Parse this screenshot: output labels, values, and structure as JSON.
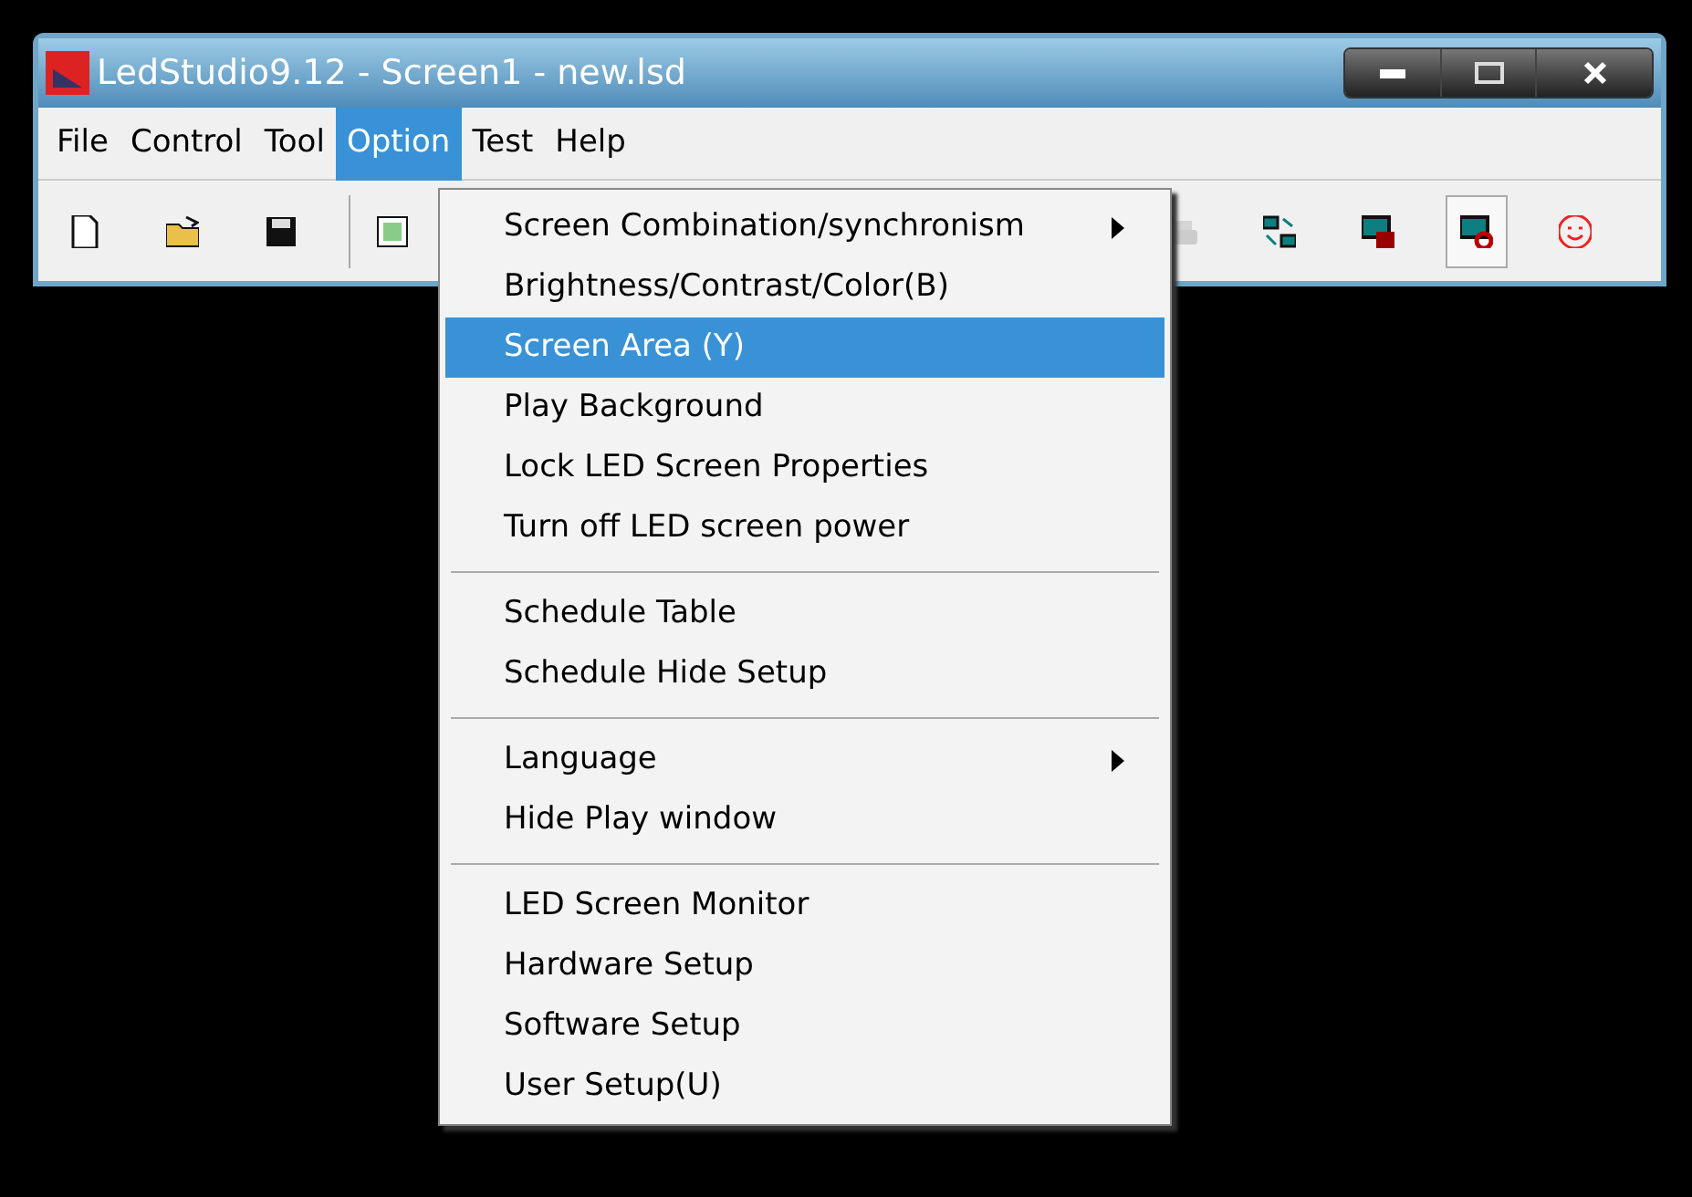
{
  "window": {
    "title": "LedStudio9.12 - Screen1 - new.lsd"
  },
  "menubar": [
    {
      "label": "File",
      "selected": false
    },
    {
      "label": "Control",
      "selected": false
    },
    {
      "label": "Tool",
      "selected": false
    },
    {
      "label": "Option",
      "selected": true
    },
    {
      "label": "Test",
      "selected": false
    },
    {
      "label": "Help",
      "selected": false
    }
  ],
  "toolbar": [
    {
      "pressed": false,
      "disabled": false
    },
    {
      "pressed": false,
      "disabled": false
    },
    {
      "pressed": false,
      "disabled": false
    },
    {
      "pressed": false,
      "disabled": false
    },
    {
      "pressed": false,
      "disabled": true
    },
    {
      "pressed": false,
      "disabled": false
    },
    {
      "pressed": false,
      "disabled": false
    },
    {
      "pressed": true,
      "disabled": false
    },
    {
      "pressed": false,
      "disabled": false
    }
  ],
  "dropdown": [
    {
      "kind": "item",
      "label": "Screen Combination/synchronism",
      "submenu": true,
      "selected": false
    },
    {
      "kind": "item",
      "label": "Brightness/Contrast/Color(B)",
      "submenu": false,
      "selected": false
    },
    {
      "kind": "item",
      "label": "Screen Area (Y)",
      "submenu": false,
      "selected": true
    },
    {
      "kind": "item",
      "label": "Play Background",
      "submenu": false,
      "selected": false
    },
    {
      "kind": "item",
      "label": "Lock LED Screen Properties",
      "submenu": false,
      "selected": false
    },
    {
      "kind": "item",
      "label": "Turn off LED screen power",
      "submenu": false,
      "selected": false
    },
    {
      "kind": "separator"
    },
    {
      "kind": "item",
      "label": "Schedule Table",
      "submenu": false,
      "selected": false
    },
    {
      "kind": "item",
      "label": "Schedule Hide Setup",
      "submenu": false,
      "selected": false
    },
    {
      "kind": "separator"
    },
    {
      "kind": "item",
      "label": "Language",
      "submenu": true,
      "selected": false
    },
    {
      "kind": "item",
      "label": "Hide Play window",
      "submenu": false,
      "selected": false
    },
    {
      "kind": "separator"
    },
    {
      "kind": "item",
      "label": "LED Screen Monitor",
      "submenu": false,
      "selected": false
    },
    {
      "kind": "item",
      "label": "Hardware Setup",
      "submenu": false,
      "selected": false
    },
    {
      "kind": "item",
      "label": "Software Setup",
      "submenu": false,
      "selected": false
    },
    {
      "kind": "item",
      "label": "User Setup(U)",
      "submenu": false,
      "selected": false
    }
  ]
}
